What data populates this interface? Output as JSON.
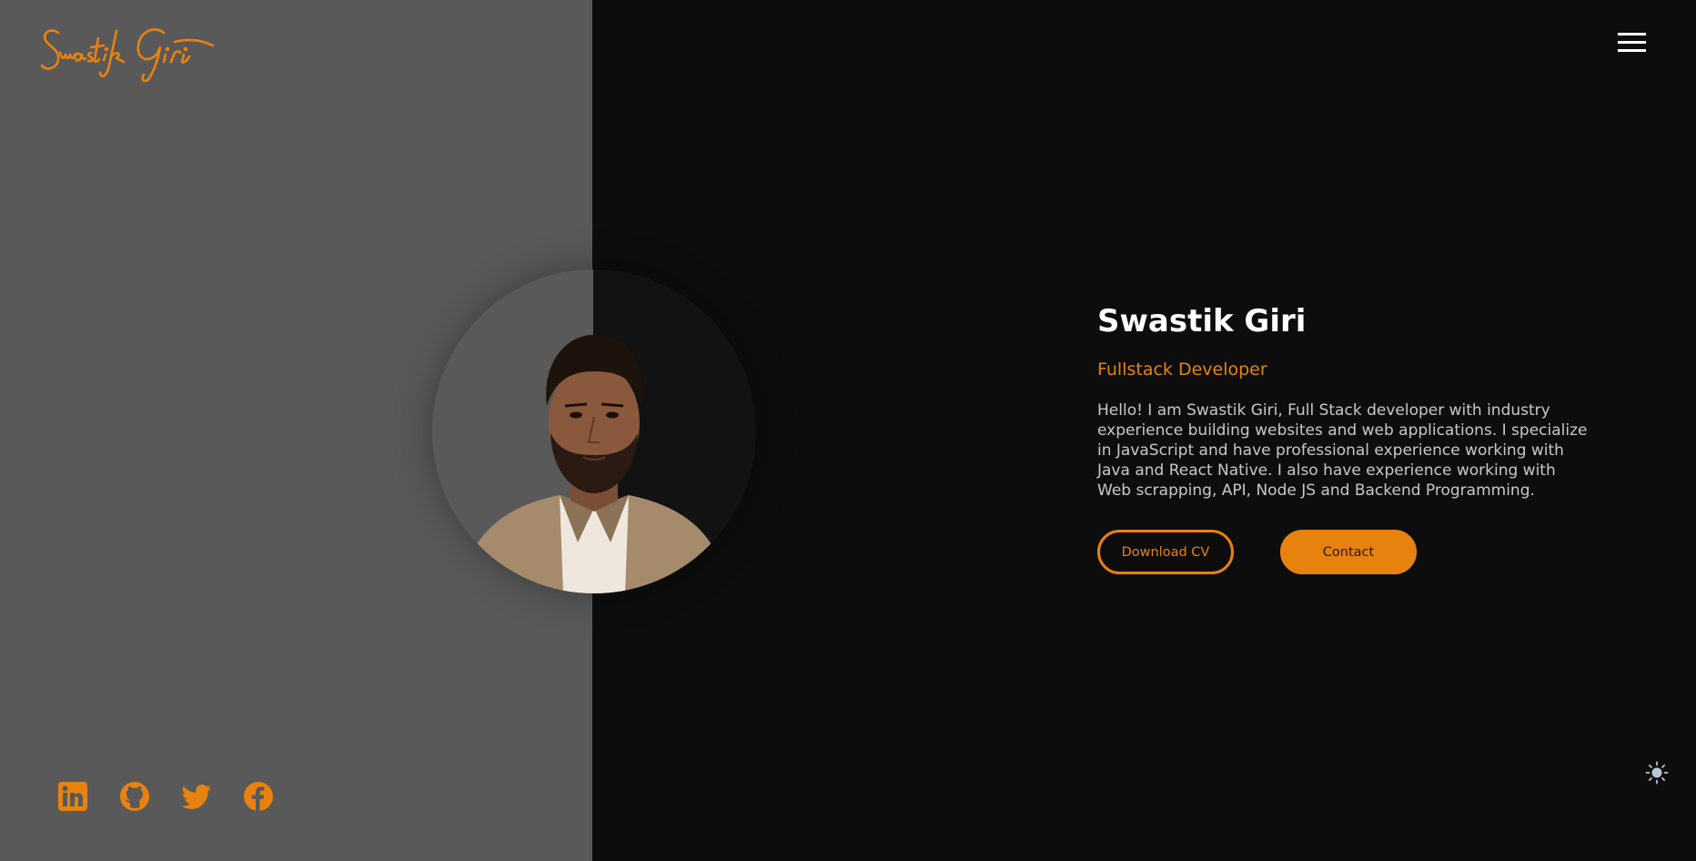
{
  "brand": {
    "logo_text": "Swastik Giri",
    "accent": "#e8820e"
  },
  "hero": {
    "name": "Swastik Giri",
    "role": "Fullstack Developer",
    "bio": "Hello! I am Swastik Giri, Full Stack developer with industry experience building websites and web applications. I specialize in JavaScript and have professional experience working with Java and React Native. I also have experience working with Web scrapping, API, Node JS and Backend Programming.",
    "download_cv_label": "Download CV",
    "contact_label": "Contact"
  },
  "socials": [
    "linkedin-icon",
    "github-icon",
    "twitter-icon",
    "facebook-icon"
  ],
  "icons": {
    "menu": "hamburger-menu-icon",
    "theme": "sun-icon"
  },
  "colors": {
    "left_panel": "#595959",
    "background": "#0d0d0d",
    "accent": "#e8820e",
    "text": "#ffffff",
    "muted": "#c8c8c8"
  }
}
